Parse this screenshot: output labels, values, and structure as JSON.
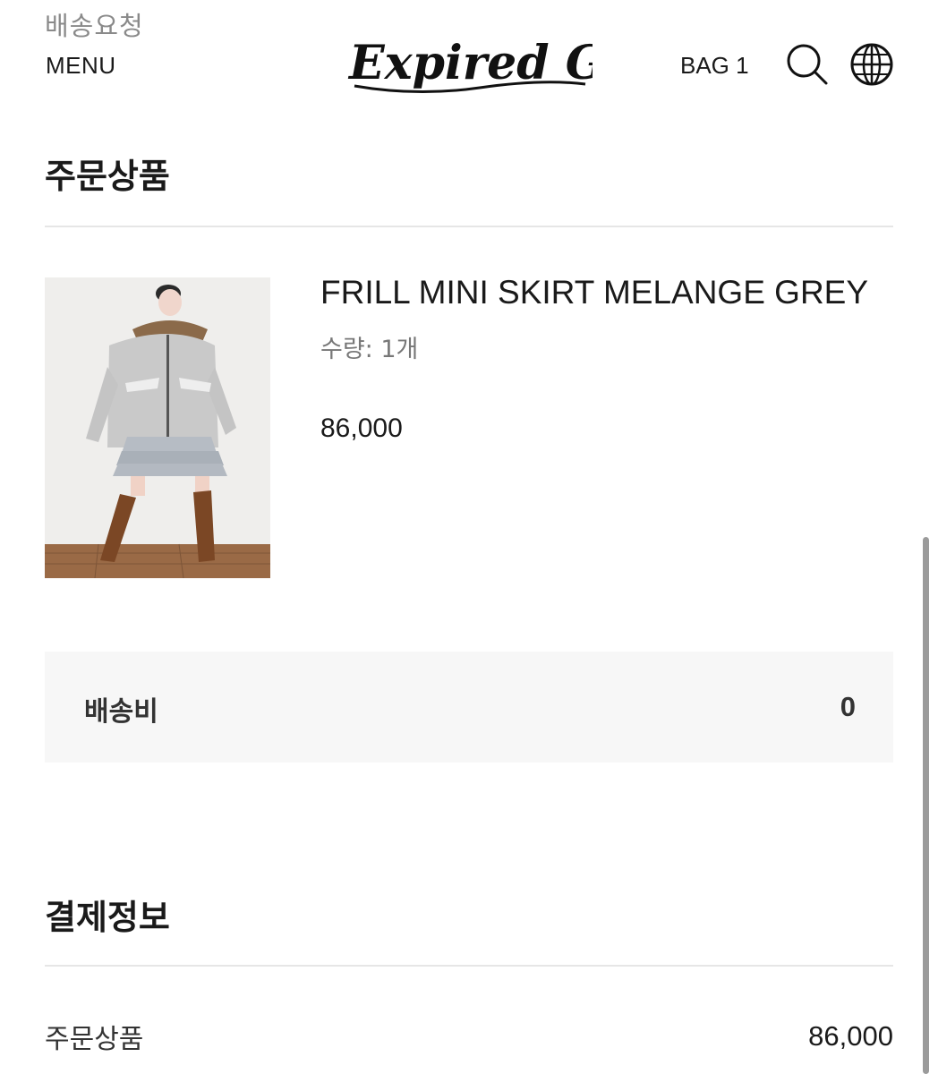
{
  "header": {
    "top_partial_text": "배송요청",
    "menu_label": "MENU",
    "logo_text": "Expired Girl",
    "bag_label": "BAG 1",
    "search_icon": "search-icon",
    "globe_icon": "globe-icon"
  },
  "order_items": {
    "title": "주문상품",
    "product": {
      "name": "FRILL MINI SKIRT MELANGE GREY",
      "quantity": "수량: 1개",
      "price": "86,000"
    }
  },
  "shipping": {
    "label": "배송비",
    "value": "0"
  },
  "payment": {
    "title": "결제정보",
    "rows": [
      {
        "label": "주문상품",
        "value": "86,000"
      }
    ]
  },
  "colors": {
    "text": "#1a1a1a",
    "muted": "#777777",
    "divider": "#e6e6e6",
    "box_bg": "#f7f7f7"
  }
}
